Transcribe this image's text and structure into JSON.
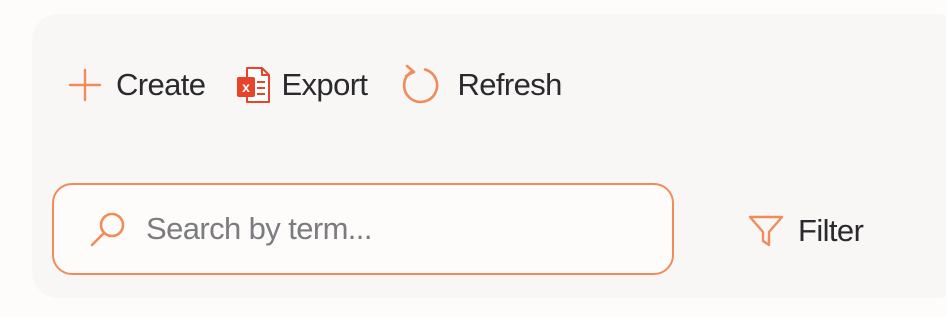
{
  "toolbar": {
    "create": {
      "label": "Create",
      "icon": "plus-icon"
    },
    "export": {
      "label": "Export",
      "icon": "excel-file-icon",
      "badge": "x"
    },
    "refresh": {
      "label": "Refresh",
      "icon": "refresh-icon"
    }
  },
  "search": {
    "placeholder": "Search by term...",
    "value": "",
    "icon": "search-icon"
  },
  "filter": {
    "label": "Filter",
    "icon": "funnel-icon"
  },
  "colors": {
    "accent": "#f28b5a",
    "excel_red": "#e8442c",
    "text": "#2a2a2e",
    "placeholder": "#7b7b80",
    "card_bg": "#f8f7f6"
  }
}
